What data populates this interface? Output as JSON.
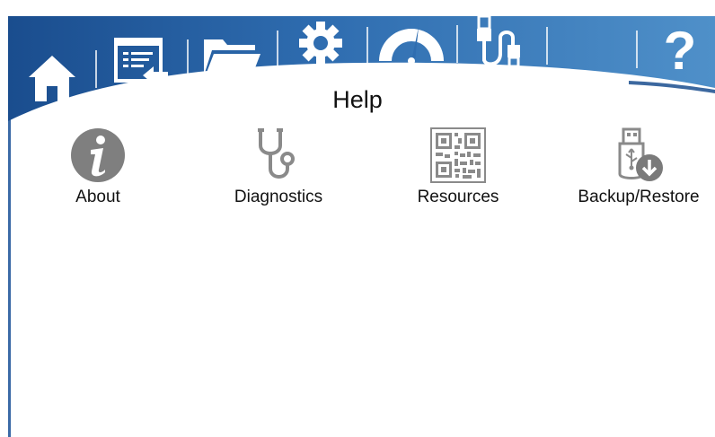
{
  "toolbar": {
    "items": [
      {
        "name": "home-button",
        "icon": "home-icon"
      },
      {
        "name": "screen-log-button",
        "icon": "screen-log-icon"
      },
      {
        "name": "files-button",
        "icon": "folder-icon"
      },
      {
        "name": "settings-button",
        "icon": "gear-icon"
      },
      {
        "name": "gauge-button",
        "icon": "gauge-icon"
      },
      {
        "name": "usb-button",
        "icon": "usb-cable-icon"
      },
      {
        "name": "help-button",
        "icon": "question-icon",
        "label": "?"
      }
    ],
    "colors": {
      "dark": "#1a4d8e",
      "light": "#4f90c9",
      "icon": "#ffffff"
    }
  },
  "page": {
    "title": "Help"
  },
  "tiles": [
    {
      "label": "About",
      "icon": "info-icon"
    },
    {
      "label": "Diagnostics",
      "icon": "stethoscope-icon"
    },
    {
      "label": "Resources",
      "icon": "qr-code-icon"
    },
    {
      "label": "Backup/Restore",
      "icon": "usb-download-icon"
    }
  ]
}
